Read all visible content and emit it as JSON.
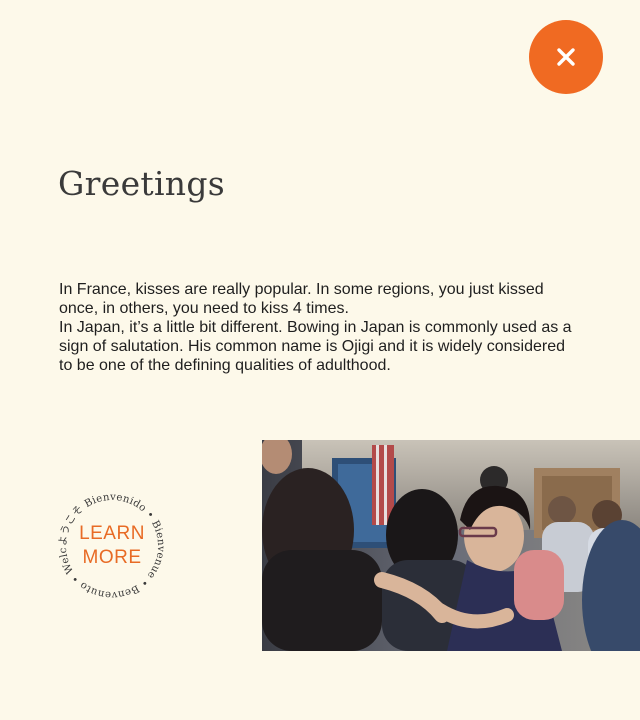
{
  "close": {
    "icon": "close-icon",
    "color": "#f06a22"
  },
  "page": {
    "title": "Greetings",
    "paragraphs": [
      "In France, kisses are really popular. In some regions, you just kissed once, in others, you need to kiss 4 times.",
      "In Japan, it’s a little bit different. Bowing in Japan is commonly used as a sign of salutation. His common name is Ojigi and it is widely considered to be one of the defining qualities of adulthood."
    ]
  },
  "learn_more": {
    "line1": "LEARN",
    "line2": "MORE",
    "ring_text": "ようこそ Bienvenido • Bienvenue • Benvenuto • Welcome •",
    "accent": "#e86b25"
  },
  "photo": {
    "alt": "people-hugging-photo"
  }
}
